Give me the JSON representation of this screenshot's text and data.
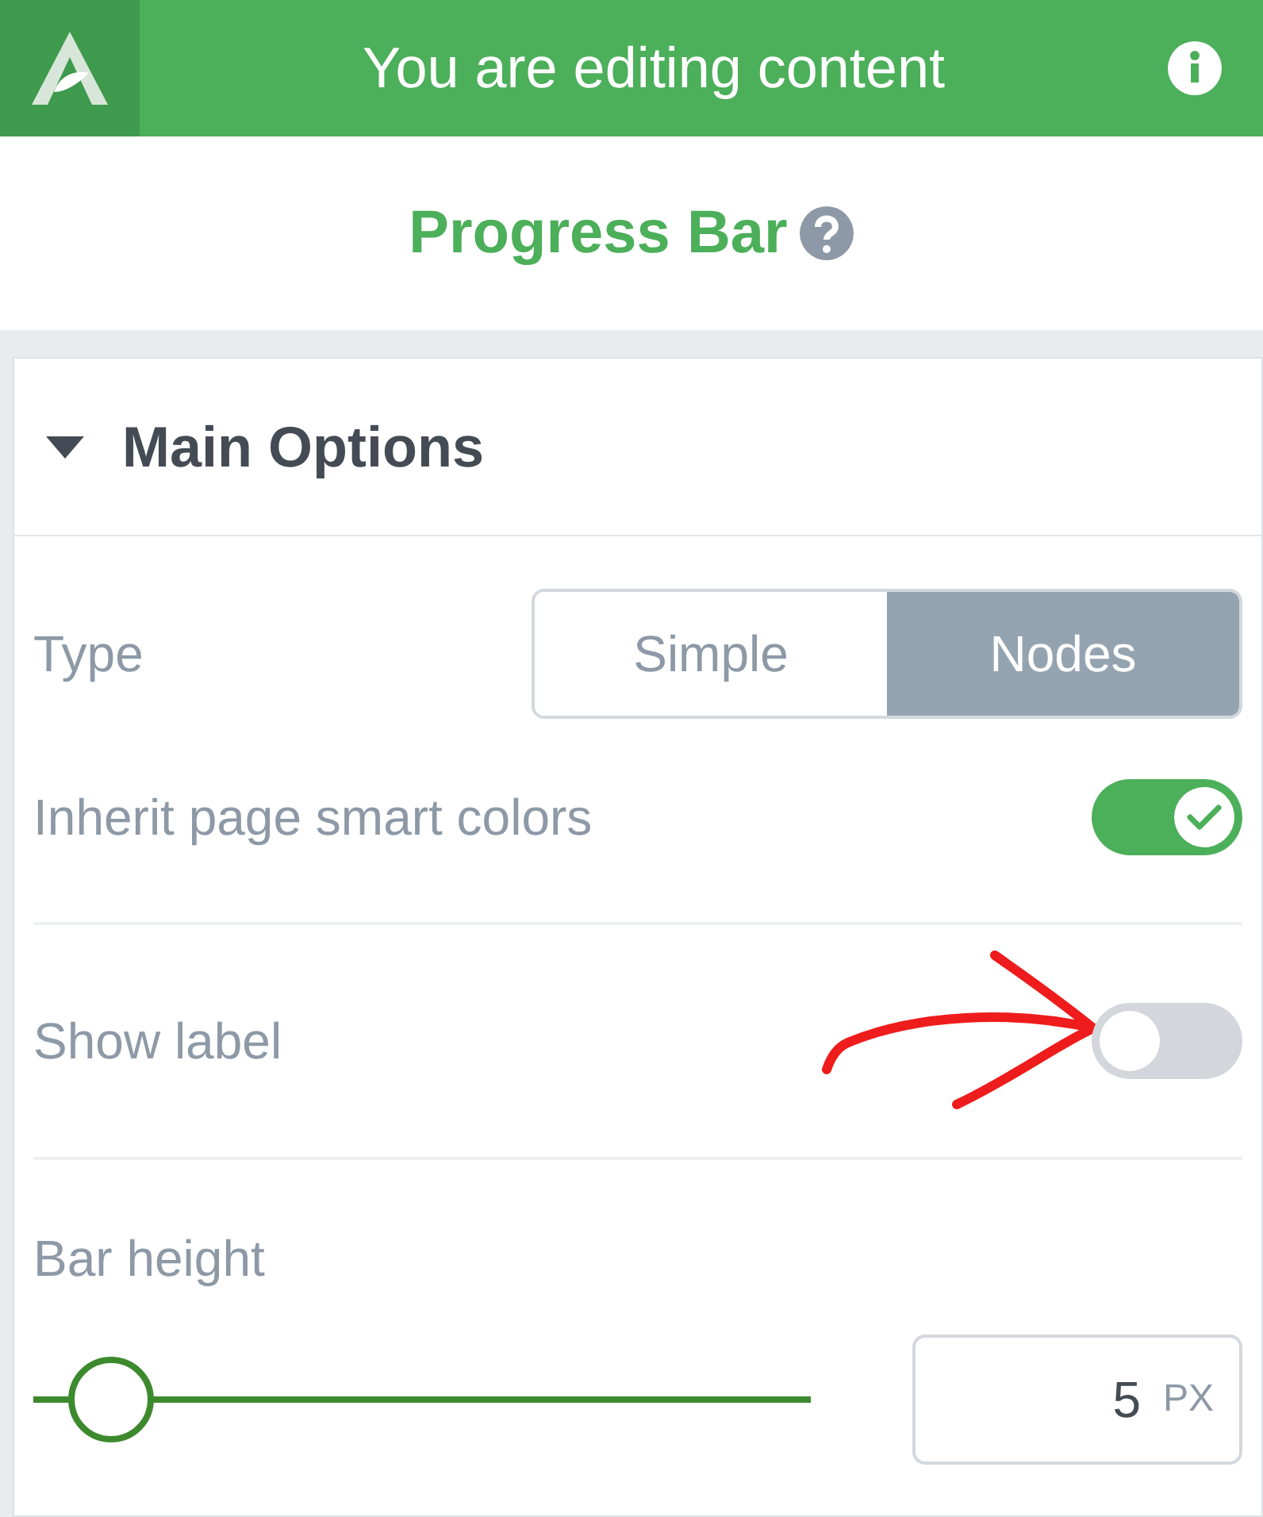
{
  "header": {
    "title": "You are editing content"
  },
  "element": {
    "title": "Progress Bar"
  },
  "section": {
    "title": "Main Options",
    "expanded": true
  },
  "type": {
    "label": "Type",
    "options": [
      {
        "label": "Simple",
        "selected": false
      },
      {
        "label": "Nodes",
        "selected": true
      }
    ]
  },
  "toggles": [
    {
      "label": "Inherit page smart colors",
      "on": true,
      "annotated": false
    },
    {
      "label": "Show label",
      "on": false,
      "annotated": true
    }
  ],
  "bar_height": {
    "label": "Bar height",
    "level": 0.05,
    "value": "5",
    "unit": "PX"
  }
}
